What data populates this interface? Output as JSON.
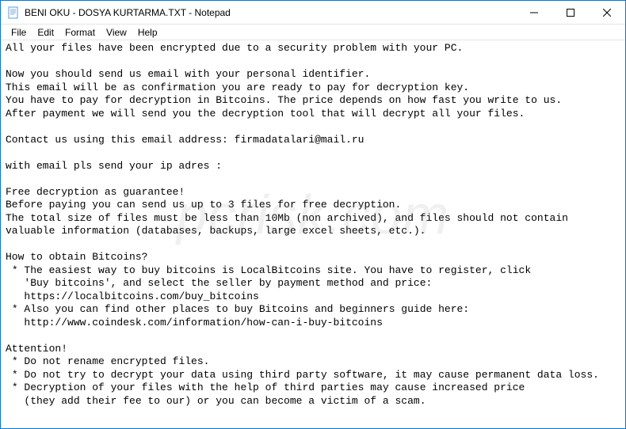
{
  "window": {
    "title": "BENI OKU - DOSYA KURTARMA.TXT - Notepad"
  },
  "menu": {
    "file": "File",
    "edit": "Edit",
    "format": "Format",
    "view": "View",
    "help": "Help"
  },
  "content": {
    "body": "All your files have been encrypted due to a security problem with your PC.\n\nNow you should send us email with your personal identifier.\nThis email will be as confirmation you are ready to pay for decryption key.\nYou have to pay for decryption in Bitcoins. The price depends on how fast you write to us.\nAfter payment we will send you the decryption tool that will decrypt all your files.\n\nContact us using this email address: firmadatalari@mail.ru\n\nwith email pls send your ip adres :\n\nFree decryption as guarantee!\nBefore paying you can send us up to 3 files for free decryption.\nThe total size of files must be less than 10Mb (non archived), and files should not contain valuable information (databases, backups, large excel sheets, etc.).\n\nHow to obtain Bitcoins?\n * The easiest way to buy bitcoins is LocalBitcoins site. You have to register, click\n   'Buy bitcoins', and select the seller by payment method and price:\n   https://localbitcoins.com/buy_bitcoins\n * Also you can find other places to buy Bitcoins and beginners guide here:\n   http://www.coindesk.com/information/how-can-i-buy-bitcoins\n\nAttention!\n * Do not rename encrypted files.\n * Do not try to decrypt your data using third party software, it may cause permanent data loss.\n * Decryption of your files with the help of third parties may cause increased price\n   (they add their fee to our) or you can become a victim of a scam."
  },
  "watermark": "pcrisk.com"
}
